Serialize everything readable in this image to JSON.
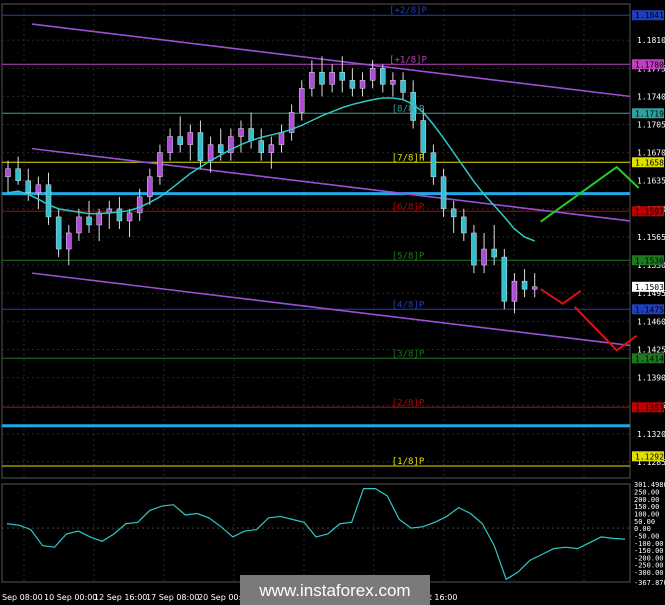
{
  "chart_data": {
    "type": "candlestick",
    "title": "",
    "main_panel": {
      "price_axis_ticks": [
        "1.1810",
        "1.1775",
        "1.1740",
        "1.1705",
        "1.1670",
        "1.1635",
        "1.1600",
        "1.1565",
        "1.1530",
        "1.1495",
        "1.1460",
        "1.1425",
        "1.1390",
        "1.1355",
        "1.1320",
        "1.1285"
      ],
      "ylim": [
        1.1265,
        1.1855
      ],
      "current_price": "1.1503",
      "price_tags": [
        {
          "value": "1.1841",
          "color": "#1f3fbf"
        },
        {
          "value": "1.1780",
          "color": "#c040c0"
        },
        {
          "value": "1.1719",
          "color": "#2fa0a0"
        },
        {
          "value": "1.1658",
          "color": "#e0e000"
        },
        {
          "value": "1.1597",
          "color": "#c00000"
        },
        {
          "value": "1.1536",
          "color": "#1e7a1e"
        },
        {
          "value": "1.1475",
          "color": "#1f3fbf"
        },
        {
          "value": "1.1414",
          "color": "#1e7a1e"
        },
        {
          "value": "1.1353",
          "color": "#c00000"
        },
        {
          "value": "1.1292",
          "color": "#e0e000"
        }
      ],
      "murrey_levels": [
        {
          "label": "[8/8]P",
          "value": 1.1719,
          "color": "#2fa0a0"
        },
        {
          "label": "[7/8]P",
          "value": 1.1658,
          "color": "#e0e000"
        },
        {
          "label": "[6/8]P",
          "value": 1.1597,
          "color": "#c00000"
        },
        {
          "label": "[5/8]P",
          "value": 1.1536,
          "color": "#1e7a1e"
        },
        {
          "label": "[4/8]P",
          "value": 1.1475,
          "color": "#1f3fbf"
        },
        {
          "label": "[3/8]P",
          "value": 1.1414,
          "color": "#1e7a1e"
        },
        {
          "label": "[2/8]P",
          "value": 1.1353,
          "color": "#c00000"
        },
        {
          "label": "[1/8]P",
          "value": 1.128,
          "color": "#e0e000"
        },
        {
          "label": "[+2/8]P",
          "value": 1.1841,
          "color": "#1f3fbf"
        },
        {
          "label": "[+1/8]P",
          "value": 1.178,
          "color": "#c040c0"
        }
      ],
      "candles": [
        [
          1.164,
          1.166,
          1.162,
          1.165
        ],
        [
          1.165,
          1.1665,
          1.163,
          1.1635
        ],
        [
          1.1635,
          1.165,
          1.161,
          1.162
        ],
        [
          1.162,
          1.164,
          1.16,
          1.163
        ],
        [
          1.163,
          1.1645,
          1.158,
          1.159
        ],
        [
          1.159,
          1.16,
          1.154,
          1.155
        ],
        [
          1.155,
          1.158,
          1.153,
          1.157
        ],
        [
          1.157,
          1.16,
          1.156,
          1.159
        ],
        [
          1.159,
          1.161,
          1.157,
          1.158
        ],
        [
          1.158,
          1.16,
          1.156,
          1.1595
        ],
        [
          1.1595,
          1.161,
          1.1575,
          1.16
        ],
        [
          1.16,
          1.1615,
          1.1575,
          1.1585
        ],
        [
          1.1585,
          1.16,
          1.1565,
          1.1595
        ],
        [
          1.1595,
          1.1625,
          1.1585,
          1.1615
        ],
        [
          1.1615,
          1.165,
          1.1605,
          1.164
        ],
        [
          1.164,
          1.168,
          1.163,
          1.167
        ],
        [
          1.167,
          1.17,
          1.166,
          1.169
        ],
        [
          1.169,
          1.1715,
          1.167,
          1.168
        ],
        [
          1.168,
          1.1705,
          1.166,
          1.1695
        ],
        [
          1.1695,
          1.171,
          1.165,
          1.166
        ],
        [
          1.166,
          1.169,
          1.1645,
          1.168
        ],
        [
          1.168,
          1.17,
          1.166,
          1.167
        ],
        [
          1.167,
          1.17,
          1.166,
          1.169
        ],
        [
          1.169,
          1.171,
          1.167,
          1.17
        ],
        [
          1.17,
          1.172,
          1.1675,
          1.1685
        ],
        [
          1.1685,
          1.17,
          1.166,
          1.167
        ],
        [
          1.167,
          1.169,
          1.165,
          1.168
        ],
        [
          1.168,
          1.1705,
          1.167,
          1.1695
        ],
        [
          1.1695,
          1.173,
          1.1685,
          1.172
        ],
        [
          1.172,
          1.176,
          1.171,
          1.175
        ],
        [
          1.175,
          1.1785,
          1.174,
          1.177
        ],
        [
          1.177,
          1.179,
          1.174,
          1.1755
        ],
        [
          1.1755,
          1.178,
          1.1745,
          1.177
        ],
        [
          1.177,
          1.179,
          1.1745,
          1.176
        ],
        [
          1.176,
          1.1775,
          1.174,
          1.175
        ],
        [
          1.175,
          1.177,
          1.174,
          1.176
        ],
        [
          1.176,
          1.1785,
          1.175,
          1.1775
        ],
        [
          1.1775,
          1.178,
          1.1745,
          1.1755
        ],
        [
          1.1755,
          1.177,
          1.174,
          1.176
        ],
        [
          1.176,
          1.177,
          1.1735,
          1.1745
        ],
        [
          1.1745,
          1.176,
          1.17,
          1.171
        ],
        [
          1.171,
          1.1725,
          1.166,
          1.167
        ],
        [
          1.167,
          1.168,
          1.163,
          1.164
        ],
        [
          1.164,
          1.165,
          1.159,
          1.16
        ],
        [
          1.16,
          1.161,
          1.157,
          1.159
        ],
        [
          1.159,
          1.16,
          1.156,
          1.157
        ],
        [
          1.157,
          1.158,
          1.152,
          1.153
        ],
        [
          1.153,
          1.157,
          1.152,
          1.155
        ],
        [
          1.155,
          1.158,
          1.153,
          1.154
        ],
        [
          1.154,
          1.155,
          1.1475,
          1.1485
        ],
        [
          1.1485,
          1.152,
          1.147,
          1.151
        ],
        [
          1.151,
          1.1525,
          1.149,
          1.15
        ],
        [
          1.15,
          1.152,
          1.149,
          1.1503
        ]
      ],
      "moving_average": [
        1.162,
        1.1622,
        1.1618,
        1.1612,
        1.1605,
        1.16,
        1.1598,
        1.1596,
        1.1594,
        1.1594,
        1.1595,
        1.1596,
        1.1598,
        1.1602,
        1.1608,
        1.1615,
        1.1624,
        1.1634,
        1.1644,
        1.1652,
        1.166,
        1.1667,
        1.1674,
        1.168,
        1.1685,
        1.1689,
        1.1692,
        1.1695,
        1.1699,
        1.1704,
        1.171,
        1.1716,
        1.1721,
        1.1726,
        1.173,
        1.1733,
        1.1736,
        1.1738,
        1.1738,
        1.1736,
        1.173,
        1.172,
        1.1705,
        1.1688,
        1.167,
        1.1652,
        1.1634,
        1.1618,
        1.1604,
        1.159,
        1.1575,
        1.1565,
        1.156
      ],
      "trend_lines": [
        {
          "points": [
            [
              0,
              1.183
            ],
            [
              1,
              1.174
            ]
          ],
          "color": "#9b4fd6"
        },
        {
          "points": [
            [
              0,
              1.1675
            ],
            [
              1,
              1.1585
            ]
          ],
          "color": "#9b4fd6"
        },
        {
          "points": [
            [
              0,
              1.152
            ],
            [
              1,
              1.143
            ]
          ],
          "color": "#9b4fd6"
        }
      ],
      "horizontal_lines": [
        {
          "value": 1.1619,
          "color": "#20a8e8"
        },
        {
          "value": 1.133,
          "color": "#20a8e8"
        }
      ]
    },
    "oscillator_panel": {
      "axis_ticks": [
        "301.4980",
        "250.00",
        "200.00",
        "150.00",
        "100.00",
        "50.00",
        "0.00",
        "-50.00",
        "-100.00",
        "-150.00",
        "-200.00",
        "-250.00",
        "-300.00",
        "-367.8700"
      ],
      "ylim": [
        -367.87,
        301.498
      ],
      "values": [
        30,
        20,
        -10,
        -120,
        -130,
        -40,
        -20,
        -60,
        -90,
        -40,
        30,
        40,
        120,
        150,
        160,
        90,
        100,
        70,
        10,
        -60,
        -20,
        -10,
        70,
        80,
        60,
        40,
        -60,
        -40,
        30,
        40,
        270,
        270,
        220,
        60,
        0,
        10,
        40,
        80,
        140,
        100,
        30,
        -120,
        -350,
        -300,
        -220,
        -180,
        -140,
        -130,
        -140,
        -100,
        -60,
        -70,
        -75
      ]
    },
    "time_axis_ticks": [
      "Sep 08:00",
      "10 Sep 00:00",
      "12 Sep 16:00",
      "17 Sep 08:00",
      "20 Sep 00:00",
      "Oct 16:00"
    ],
    "watermark": "www.instaforex.com"
  }
}
